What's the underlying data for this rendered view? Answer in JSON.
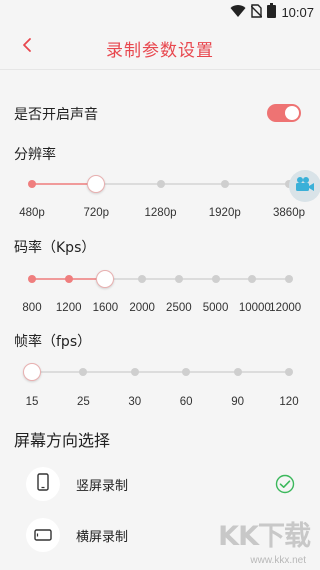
{
  "status_bar": {
    "time": "10:07",
    "icons": [
      "wifi-icon",
      "sim-off-icon",
      "battery-icon"
    ]
  },
  "header": {
    "title": "录制参数设置",
    "back_icon": "chevron-left-icon"
  },
  "sound": {
    "label": "是否开启声音",
    "enabled": true
  },
  "resolution": {
    "label": "分辨率",
    "options": [
      "480p",
      "720p",
      "1280p",
      "1920p",
      "3860p"
    ],
    "selected": "720p"
  },
  "bitrate": {
    "label": "码率（Kps）",
    "options": [
      "800",
      "1200",
      "1600",
      "2000",
      "2500",
      "5000",
      "10000",
      "12000"
    ],
    "selected": "1600"
  },
  "framerate": {
    "label": "帧率（fps）",
    "options": [
      "15",
      "25",
      "30",
      "60",
      "90",
      "120"
    ],
    "selected": "15"
  },
  "orientation": {
    "title": "屏幕方向选择",
    "options": [
      {
        "label": "竖屏录制",
        "icon": "portrait-phone-icon",
        "selected": true
      },
      {
        "label": "横屏录制",
        "icon": "landscape-phone-icon",
        "selected": false
      }
    ]
  },
  "floating_button": {
    "icon": "video-camera-icon"
  },
  "watermark": {
    "text": "KK下载",
    "url": "www.kkx.net"
  },
  "colors": {
    "accent": "#e8474e",
    "track_active": "#f09a9a",
    "toggle_on": "#ee7373",
    "check": "#3cb85c"
  }
}
